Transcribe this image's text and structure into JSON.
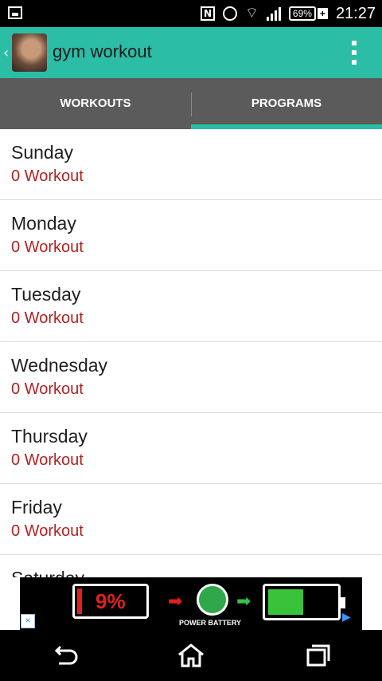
{
  "status_bar": {
    "battery_percent": "69%",
    "time": "21:27"
  },
  "app": {
    "title": "gym workout"
  },
  "tabs": [
    {
      "label": "WORKOUTS",
      "active": false
    },
    {
      "label": "PROGRAMS",
      "active": true
    }
  ],
  "days": [
    {
      "name": "Sunday",
      "count": "0 Workout"
    },
    {
      "name": "Monday",
      "count": "0 Workout"
    },
    {
      "name": "Tuesday",
      "count": "0 Workout"
    },
    {
      "name": "Wednesday",
      "count": "0 Workout"
    },
    {
      "name": "Thursday",
      "count": "0 Workout"
    },
    {
      "name": "Friday",
      "count": "0 Workout"
    },
    {
      "name": "Saturday",
      "count": ""
    }
  ],
  "ad": {
    "battery_level_text": "9%",
    "brand": "POWER BATTERY"
  },
  "colors": {
    "accent": "#2bbda6",
    "tab_bg": "#5b5b5b",
    "count_text": "#b22222"
  },
  "nav": {
    "icons": [
      "back-icon",
      "home-icon",
      "recents-icon"
    ]
  }
}
